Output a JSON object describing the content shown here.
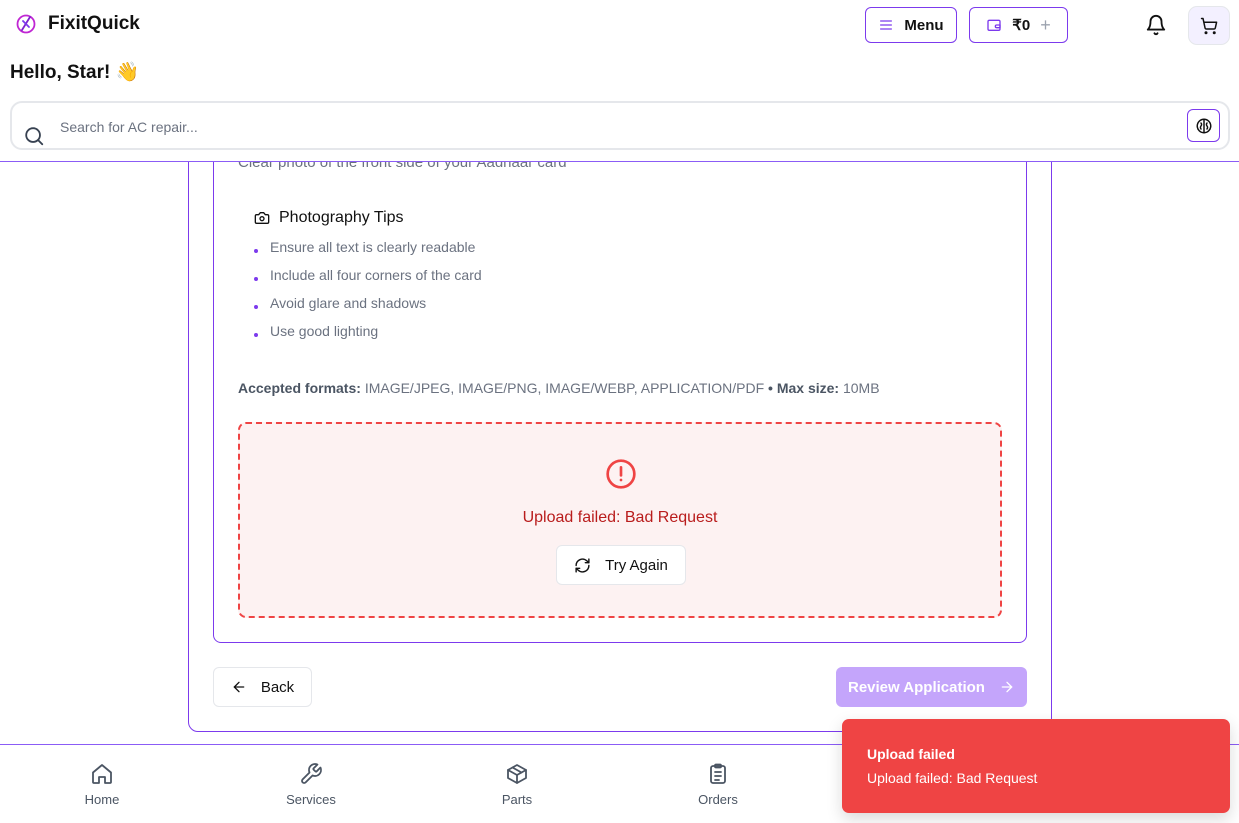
{
  "app": {
    "name": "FixitQuick"
  },
  "header": {
    "menu_label": "Menu",
    "wallet_balance": "₹0",
    "wallet_add": "+",
    "greeting": "Hello, Star! 👋",
    "search": {
      "placeholder": "Search for AC repair..."
    }
  },
  "document_step": {
    "description": "Clear photo of the front side of your Aadhaar card",
    "tips_title": "Photography Tips",
    "tips": [
      "Ensure all text is clearly readable",
      "Include all four corners of the card",
      "Avoid glare and shadows",
      "Use good lighting"
    ],
    "formats_label": "Accepted formats:",
    "formats_value": "IMAGE/JPEG, IMAGE/PNG, IMAGE/WEBP, APPLICATION/PDF",
    "separator": "•",
    "max_size_label": "Max size:",
    "max_size_value": "10MB",
    "error": {
      "message": "Upload failed: Bad Request",
      "retry_label": "Try Again"
    }
  },
  "actions": {
    "back_label": "Back",
    "review_label": "Review Application"
  },
  "bottom_nav": {
    "items": [
      {
        "label": "Home",
        "icon": "home-icon"
      },
      {
        "label": "Services",
        "icon": "wrench-icon"
      },
      {
        "label": "Parts",
        "icon": "package-icon"
      },
      {
        "label": "Orders",
        "icon": "clipboard-icon"
      }
    ]
  },
  "toast": {
    "title": "Upload failed",
    "message": "Upload failed: Bad Request"
  },
  "colors": {
    "accent": "#7c3aed",
    "error": "#ef4444",
    "error_bg": "#fdf2f2",
    "disabled_accent": "#c4a5fb"
  }
}
